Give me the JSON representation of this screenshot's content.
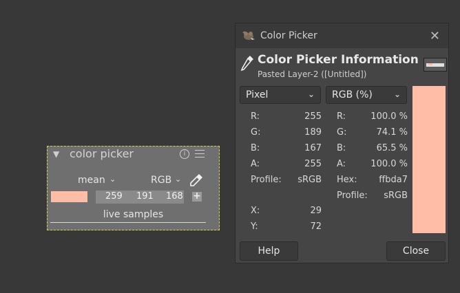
{
  "module": {
    "title": "color picker",
    "statistic": "mean",
    "color_model": "RGB",
    "values": [
      "259",
      "191",
      "168"
    ],
    "add_label": "+",
    "live_samples_label": "live samples",
    "swatch_color": "#ffbda7"
  },
  "dialog": {
    "title": "Color Picker",
    "heading": "Color Picker Information",
    "subheading": "Pasted Layer-2 ([Untitled])",
    "left_mode": "Pixel",
    "right_mode": "RGB (%)",
    "left_rows": [
      {
        "label": "R:",
        "value": "255"
      },
      {
        "label": "G:",
        "value": "189"
      },
      {
        "label": "B:",
        "value": "167"
      },
      {
        "label": "A:",
        "value": "255"
      },
      {
        "label": "Profile:",
        "value": "sRGB"
      }
    ],
    "position_rows": [
      {
        "label": "X:",
        "value": "29"
      },
      {
        "label": "Y:",
        "value": "72"
      }
    ],
    "right_rows": [
      {
        "label": "R:",
        "value": "100.0 %"
      },
      {
        "label": "G:",
        "value": "74.1 %"
      },
      {
        "label": "B:",
        "value": "65.5 %"
      },
      {
        "label": "A:",
        "value": "100.0 %"
      },
      {
        "label": "Hex:",
        "value": "ffbda7"
      },
      {
        "label": "Profile:",
        "value": "sRGB"
      }
    ],
    "help_label": "Help",
    "close_label": "Close",
    "swatch_color": "#ffbda7"
  }
}
